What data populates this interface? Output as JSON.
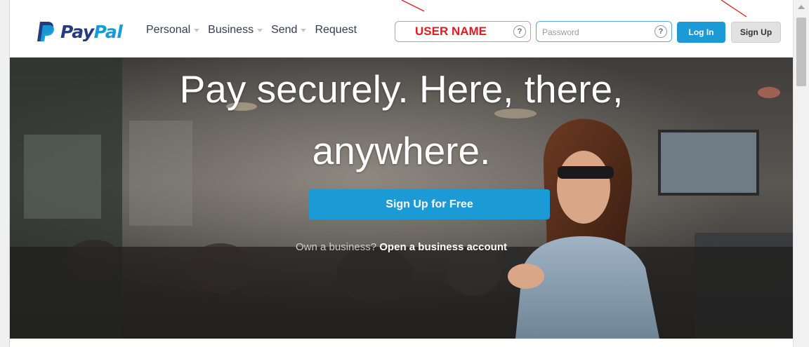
{
  "header": {
    "logo": {
      "pay": "Pay",
      "pal": "Pal"
    },
    "nav": [
      {
        "label": "Personal",
        "has_dropdown": true
      },
      {
        "label": "Business",
        "has_dropdown": true
      },
      {
        "label": "Send",
        "has_dropdown": true
      },
      {
        "label": "Request",
        "has_dropdown": false
      }
    ],
    "username": {
      "placeholder": "USER NAME",
      "value": ""
    },
    "password": {
      "placeholder": "Password",
      "value": ""
    },
    "help_glyph": "?",
    "login_label": "Log In",
    "signup_label": "Sign Up"
  },
  "hero": {
    "title_line1": "Pay securely. Here, there,",
    "title_line2": "anywhere.",
    "cta_label": "Sign Up for Free",
    "business_prompt": "Own a business?",
    "business_link": "Open a business account"
  },
  "colors": {
    "accent": "#1b9ad6",
    "logo_dark": "#253b80",
    "logo_light": "#179bd7",
    "annotation": "#e21b22"
  },
  "icons": [
    "paypal-logo-icon",
    "help-icon",
    "caret-down-icon"
  ]
}
